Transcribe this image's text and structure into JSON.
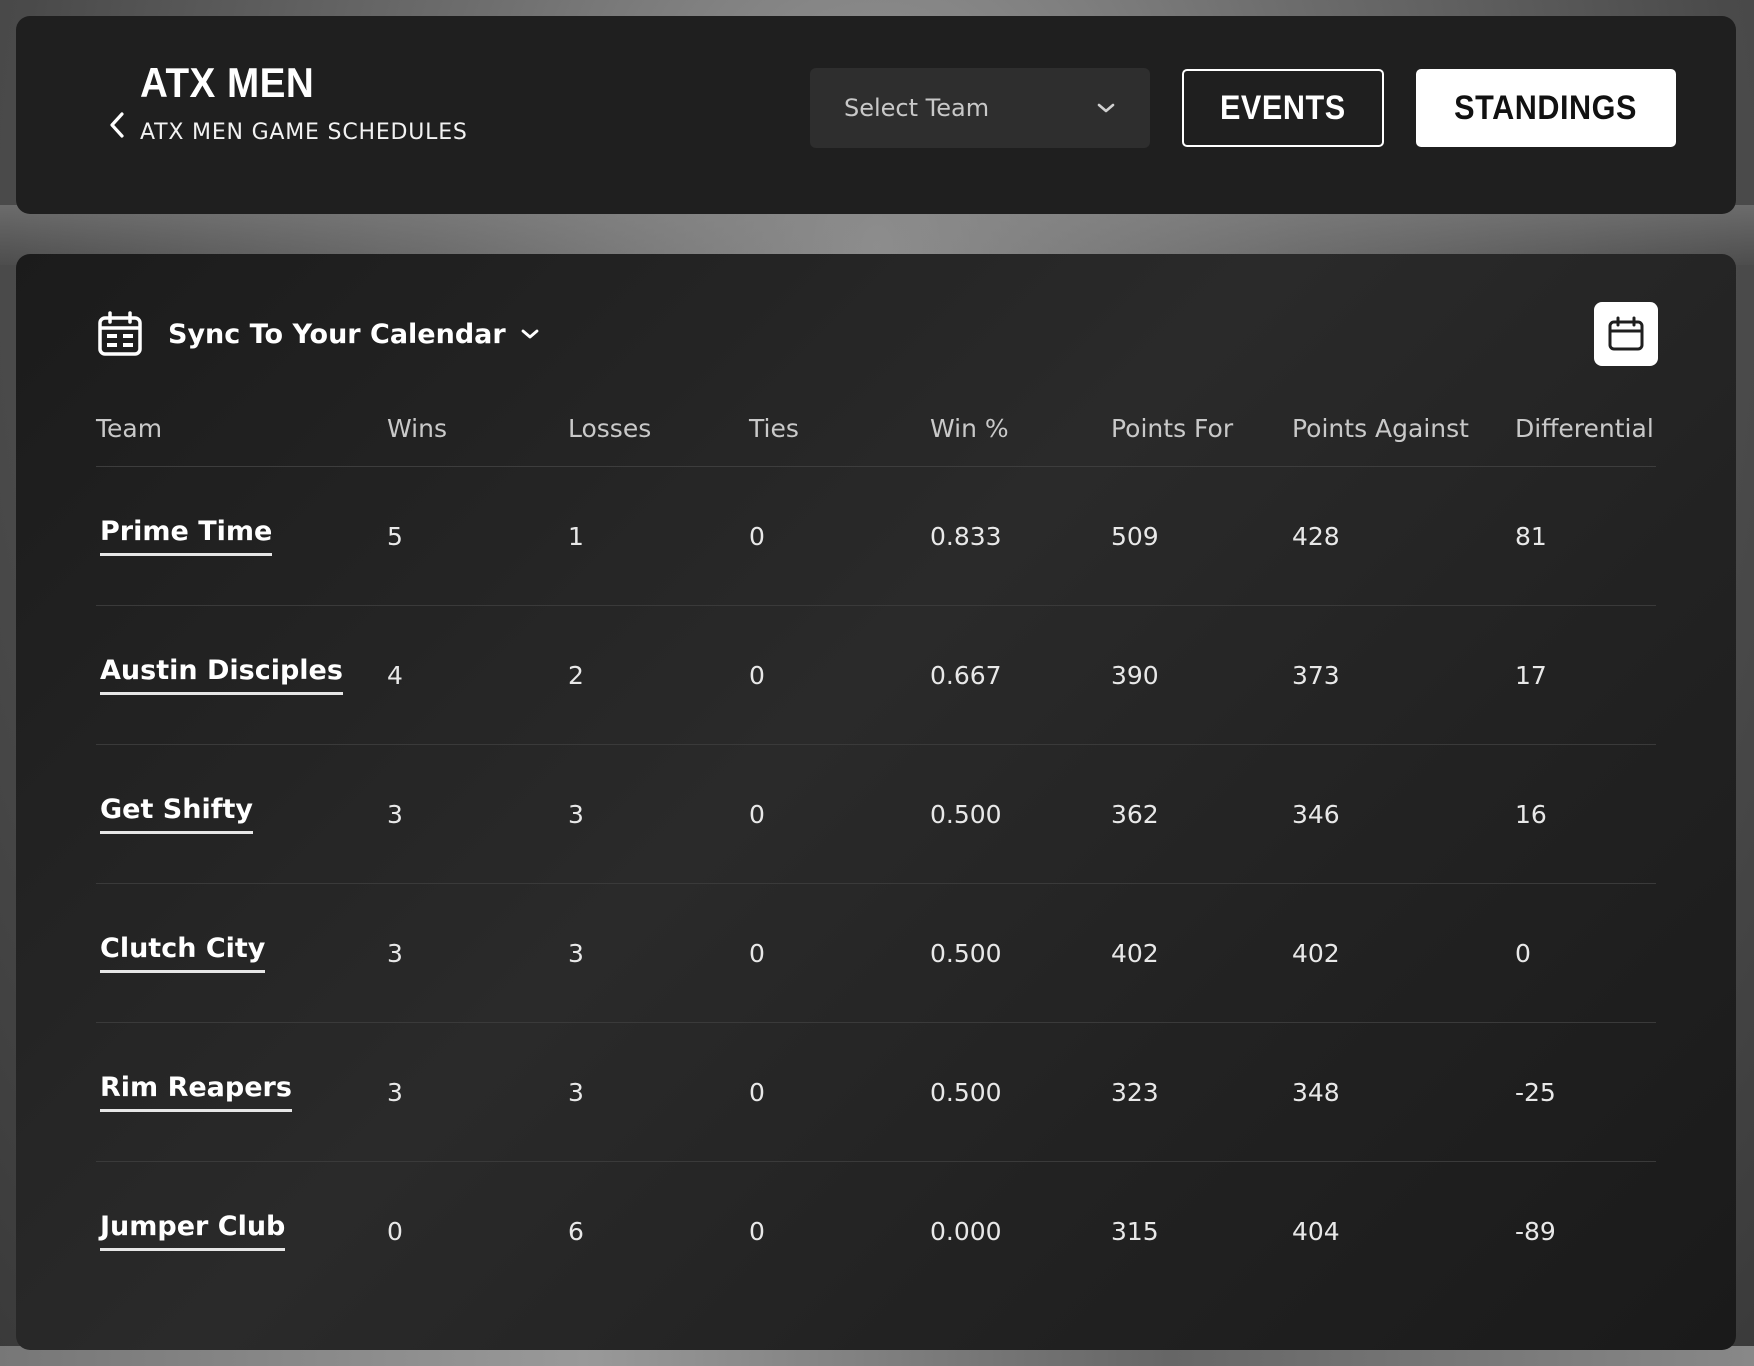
{
  "header": {
    "title": "ATX MEN",
    "subtitle": "ATX MEN GAME SCHEDULES",
    "select_team_placeholder": "Select Team",
    "events_label": "EVENTS",
    "standings_label": "STANDINGS"
  },
  "sync": {
    "label": "Sync To Your Calendar"
  },
  "table": {
    "columns": [
      "Team",
      "Wins",
      "Losses",
      "Ties",
      "Win %",
      "Points For",
      "Points Against",
      "Differential"
    ],
    "rows": [
      {
        "team": "Prime Time",
        "wins": "5",
        "losses": "1",
        "ties": "0",
        "win_pct": "0.833",
        "points_for": "509",
        "points_against": "428",
        "differential": "81"
      },
      {
        "team": "Austin Disciples",
        "wins": "4",
        "losses": "2",
        "ties": "0",
        "win_pct": "0.667",
        "points_for": "390",
        "points_against": "373",
        "differential": "17"
      },
      {
        "team": "Get Shifty",
        "wins": "3",
        "losses": "3",
        "ties": "0",
        "win_pct": "0.500",
        "points_for": "362",
        "points_against": "346",
        "differential": "16"
      },
      {
        "team": "Clutch City",
        "wins": "3",
        "losses": "3",
        "ties": "0",
        "win_pct": "0.500",
        "points_for": "402",
        "points_against": "402",
        "differential": "0"
      },
      {
        "team": "Rim Reapers",
        "wins": "3",
        "losses": "3",
        "ties": "0",
        "win_pct": "0.500",
        "points_for": "323",
        "points_against": "348",
        "differential": "-25"
      },
      {
        "team": "Jumper Club",
        "wins": "0",
        "losses": "6",
        "ties": "0",
        "win_pct": "0.000",
        "points_for": "315",
        "points_against": "404",
        "differential": "-89"
      }
    ]
  },
  "icons": {
    "back": "chevron-left-icon",
    "select_caret": "chevron-down-icon",
    "sync_calendar": "calendar-grid-icon",
    "sync_caret": "chevron-down-icon",
    "calendar_button": "calendar-icon"
  },
  "colors": {
    "card_bg": "#1f1f1f",
    "select_bg": "#2e2e2e",
    "primary_button_bg": "#ffffff",
    "primary_button_text": "#111111"
  }
}
